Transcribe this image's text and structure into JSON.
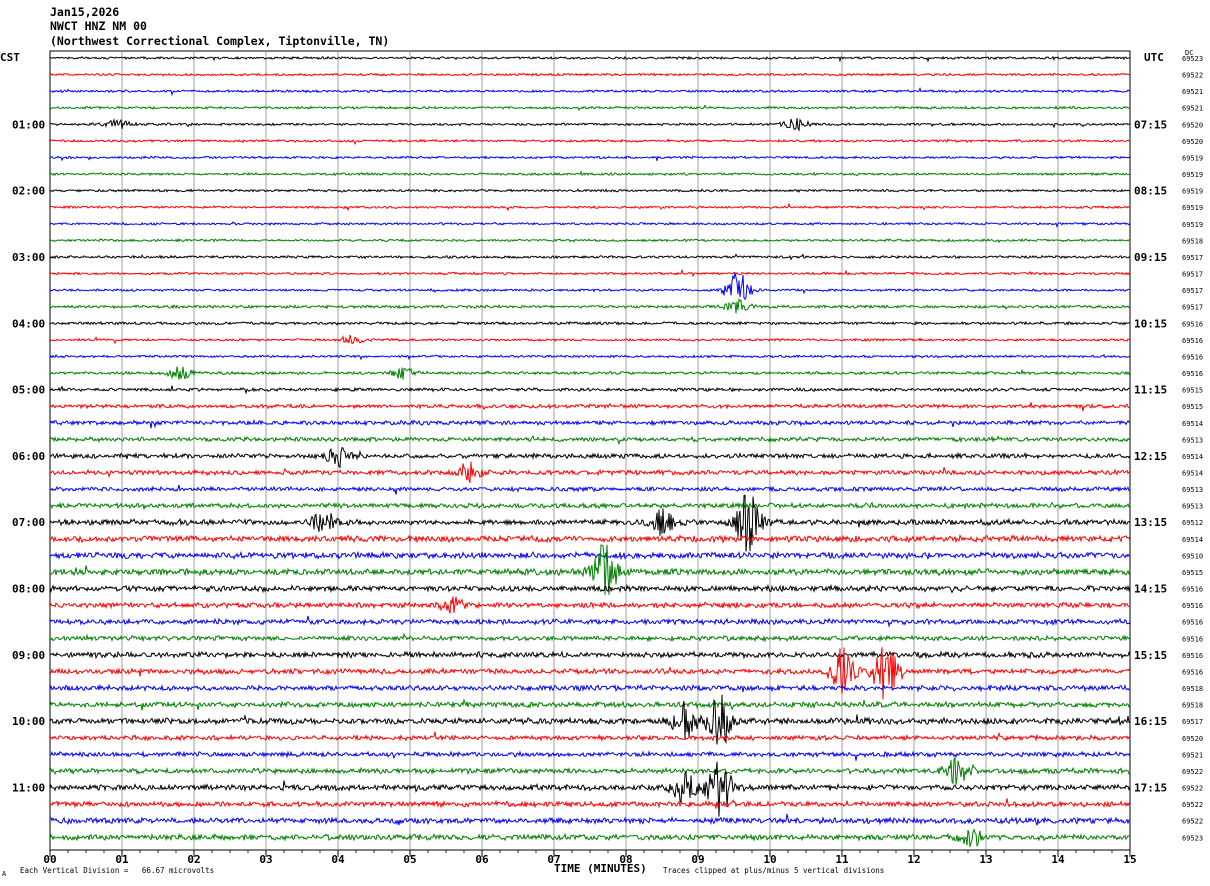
{
  "header": {
    "date": "Jan15,2026",
    "station": "NWCT HNZ NM 00",
    "location": "(Northwest Correctional Complex, Tiptonville, TN)"
  },
  "left_zone_label": "CST",
  "right_zone_label": "UTC",
  "dc_label": "DC",
  "footer": {
    "scale_note": "Each Vertical Division =   66.67 microvolts",
    "clip_note": "Traces clipped at plus/minus 5 vertical divisions",
    "logo_mark": "A"
  },
  "chart_data": {
    "type": "line",
    "title": "",
    "xlabel": "TIME (MINUTES)",
    "x_ticks": [
      "00",
      "01",
      "02",
      "03",
      "04",
      "05",
      "06",
      "07",
      "08",
      "09",
      "10",
      "11",
      "12",
      "13",
      "14",
      "15"
    ],
    "xlim": [
      0,
      15
    ],
    "left_hour_labels": [
      "01:00",
      "02:00",
      "03:00",
      "04:00",
      "05:00",
      "06:00",
      "07:00",
      "08:00",
      "09:00",
      "10:00",
      "11:00"
    ],
    "right_hour_labels": [
      "07:15",
      "08:15",
      "09:15",
      "10:15",
      "11:15",
      "12:15",
      "13:15",
      "14:15",
      "15:15",
      "16:15",
      "17:15"
    ],
    "trace_colors": [
      "#000000",
      "#ff0000",
      "#0000ff",
      "#008000"
    ],
    "dc_offsets": [
      "69523",
      "69522",
      "69521",
      "69521",
      "69520",
      "69520",
      "69519",
      "69519",
      "69519",
      "69519",
      "69519",
      "69518",
      "69517",
      "69517",
      "69517",
      "69517",
      "69516",
      "69516",
      "69516",
      "69516",
      "69515",
      "69515",
      "69514",
      "69513",
      "69514",
      "69514",
      "69513",
      "69513",
      "69512",
      "69514",
      "69510",
      "69515",
      "69516",
      "69516",
      "69516",
      "69516",
      "69516",
      "69516",
      "69518",
      "69518",
      "69517",
      "69520",
      "69521",
      "69522",
      "69522",
      "69522",
      "69522",
      "69523"
    ],
    "trace_noise_level": [
      1,
      1,
      1,
      1,
      1,
      1,
      1,
      1,
      1,
      1,
      1,
      1,
      1.1,
      1,
      1,
      1.2,
      1.2,
      1,
      1,
      1.2,
      1.4,
      1.6,
      1.8,
      1.8,
      2,
      2,
      1.8,
      2,
      2.4,
      2.6,
      2.6,
      2.6,
      2.4,
      2.2,
      2.2,
      2,
      2.4,
      2.2,
      2.2,
      2.2,
      2.6,
      2,
      2,
      2.2,
      2.4,
      2.2,
      2.4,
      2.4
    ],
    "events": [
      {
        "trace": 4,
        "minute": 0.95,
        "amp": 4
      },
      {
        "trace": 4,
        "minute": 10.35,
        "amp": 6
      },
      {
        "trace": 14,
        "minute": 9.55,
        "amp": 18
      },
      {
        "trace": 15,
        "minute": 9.55,
        "amp": 6
      },
      {
        "trace": 17,
        "minute": 4.2,
        "amp": 5
      },
      {
        "trace": 19,
        "minute": 1.8,
        "amp": 6
      },
      {
        "trace": 19,
        "minute": 4.9,
        "amp": 6
      },
      {
        "trace": 24,
        "minute": 4.0,
        "amp": 10
      },
      {
        "trace": 25,
        "minute": 5.8,
        "amp": 12
      },
      {
        "trace": 28,
        "minute": 9.7,
        "amp": 30
      },
      {
        "trace": 28,
        "minute": 8.5,
        "amp": 12
      },
      {
        "trace": 28,
        "minute": 3.8,
        "amp": 10
      },
      {
        "trace": 31,
        "minute": 7.7,
        "amp": 28
      },
      {
        "trace": 33,
        "minute": 5.6,
        "amp": 8
      },
      {
        "trace": 37,
        "minute": 11.6,
        "amp": 30
      },
      {
        "trace": 37,
        "minute": 11.0,
        "amp": 22
      },
      {
        "trace": 40,
        "minute": 8.8,
        "amp": 20
      },
      {
        "trace": 40,
        "minute": 9.3,
        "amp": 26
      },
      {
        "trace": 44,
        "minute": 9.3,
        "amp": 28
      },
      {
        "trace": 44,
        "minute": 8.8,
        "amp": 14
      },
      {
        "trace": 43,
        "minute": 12.6,
        "amp": 12
      },
      {
        "trace": 47,
        "minute": 12.8,
        "amp": 8
      }
    ]
  }
}
